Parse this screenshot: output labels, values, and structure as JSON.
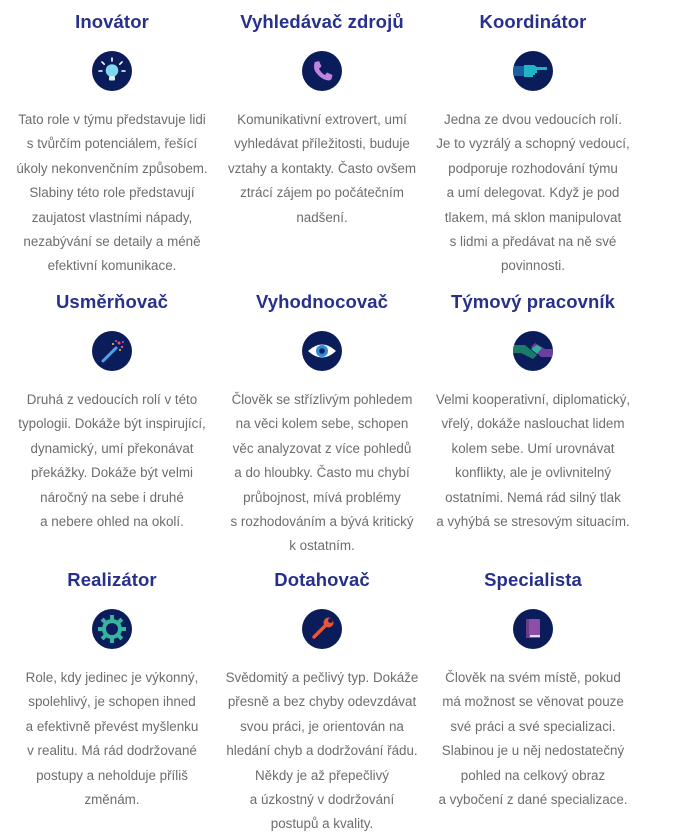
{
  "roles": [
    {
      "title": "Inovátor",
      "icon": "lightbulb-icon",
      "lines": [
        "Tato role v týmu představuje lidi",
        "s tvůrčím potenciálem, řešící",
        "úkoly nekonvenčním způsobem.",
        "Slabiny této role představují",
        "zaujatost vlastními nápady,",
        "nezabývání se detaily a méně",
        "efektivní komunikace."
      ]
    },
    {
      "title": "Vyhledávač zdrojů",
      "icon": "phone-icon",
      "lines": [
        "Komunikativní extrovert, umí",
        "vyhledávat příležitosti, buduje",
        "vztahy a kontakty. Často ovšem",
        "ztrácí zájem po počátečním",
        "nadšení."
      ]
    },
    {
      "title": "Koordinátor",
      "icon": "pointing-hand-icon",
      "lines": [
        "Jedna ze dvou vedoucích rolí.",
        "Je to vyzrálý a schopný vedoucí,",
        "podporuje rozhodování týmu",
        "a umí delegovat. Když je pod",
        "tlakem, má sklon manipulovat",
        "s lidmi a předávat na ně své",
        "povinnosti."
      ]
    },
    {
      "title": "Usměrňovač",
      "icon": "magic-wand-icon",
      "lines": [
        "Druhá z vedoucích rolí v této",
        "typologii. Dokáže být inspirující,",
        "dynamický, umí překonávat",
        "překážky. Dokáže být velmi",
        "náročný na sebe i druhé",
        "a nebere ohled na okolí."
      ]
    },
    {
      "title": "Vyhodnocovač",
      "icon": "eye-icon",
      "lines": [
        "Člověk se střízlivým pohledem",
        "na věci kolem sebe, schopen",
        "věc analyzovat z více pohledů",
        "a do hloubky. Často mu chybí",
        "průbojnost, mívá problémy",
        "s rozhodováním a bývá kritický",
        "k ostatním."
      ]
    },
    {
      "title": "Týmový pracovník",
      "icon": "handshake-icon",
      "lines": [
        "Velmi kooperativní, diplomatický,",
        "vřelý, dokáže naslouchat lidem",
        "kolem sebe. Umí urovnávat",
        "konflikty, ale je ovlivnitelný",
        "ostatními. Nemá rád silný tlak",
        "a vyhýbá se stresovým situacím."
      ]
    },
    {
      "title": "Realizátor",
      "icon": "gear-icon",
      "lines": [
        "Role, kdy jedinec je výkonný,",
        "spolehlivý, je schopen ihned",
        "a efektivně převést myšlenku",
        "v realitu. Má rád dodržované",
        "postupy a neholduje příliš",
        "změnám."
      ]
    },
    {
      "title": "Dotahovač",
      "icon": "wrench-icon",
      "lines": [
        "Svědomitý a pečlivý typ. Dokáže",
        "přesně a bez chyby odevzdávat",
        "svou práci, je orientován na",
        "hledání chyb a dodržování řádu.",
        "Někdy je až přepečlivý",
        "a úzkostný v dodržování",
        "postupů a kvality."
      ]
    },
    {
      "title": "Specialista",
      "icon": "book-icon",
      "lines": [
        "Člověk na svém místě, pokud",
        "má možnost se věnovat pouze",
        "své práci a své specializaci.",
        "Slabinou je u něj nedostatečný",
        "pohled na celkový obraz",
        "a vybočení z dané specializace."
      ]
    }
  ],
  "colors": {
    "title": "#27318b",
    "text": "#6d6d6d",
    "icon_bg": "#0b1c5a"
  }
}
